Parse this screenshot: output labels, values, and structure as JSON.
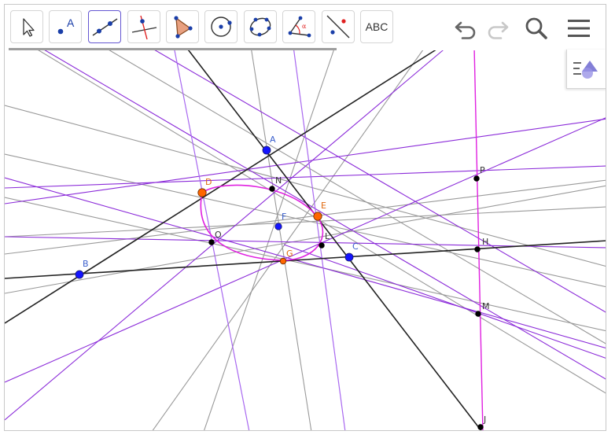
{
  "toolbar": {
    "tools": [
      {
        "name": "move-tool",
        "icon": "cursor-arrow-icon"
      },
      {
        "name": "point-tool",
        "icon": "point-icon",
        "glyph": "A"
      },
      {
        "name": "line-tool",
        "icon": "line-through-two-points-icon"
      },
      {
        "name": "perpendicular-line-tool",
        "icon": "perpendicular-line-icon"
      },
      {
        "name": "polygon-tool",
        "icon": "polygon-icon"
      },
      {
        "name": "circle-tool",
        "icon": "circle-center-point-icon"
      },
      {
        "name": "conic-tool",
        "icon": "conic-five-points-icon"
      },
      {
        "name": "angle-tool",
        "icon": "angle-icon",
        "glyph": "α"
      },
      {
        "name": "reflect-tool",
        "icon": "reflect-about-line-icon"
      },
      {
        "name": "text-tool",
        "icon": "text-icon",
        "label": "ABC"
      }
    ],
    "selected_tool": "line-tool",
    "undo_icon": "undo-icon",
    "redo_icon": "redo-icon",
    "search_icon": "search-icon",
    "menu_icon": "hamburger-menu-icon"
  },
  "style_bar": {
    "icon": "style-bar-toggle-icon"
  },
  "colors": {
    "blue_point": "#1414ff",
    "orange_point": "#ff6600",
    "black_point": "#000000",
    "purple_line": "#8b2bd9",
    "light_purple_line": "#a868f0",
    "magenta_line": "#e020e0",
    "gray_line": "#999999",
    "black_line": "#222222",
    "blue_label": "#3a5fcd",
    "orange_label": "#e06a10",
    "black_label": "#333333",
    "accent": "#6557d2"
  },
  "points": [
    {
      "label": "A",
      "kind": "blue"
    },
    {
      "label": "B",
      "kind": "blue"
    },
    {
      "label": "C",
      "kind": "blue"
    },
    {
      "label": "D",
      "kind": "orange"
    },
    {
      "label": "E",
      "kind": "orange"
    },
    {
      "label": "F",
      "kind": "blue"
    },
    {
      "label": "G",
      "kind": "orange"
    },
    {
      "label": "N",
      "kind": "black"
    },
    {
      "label": "O",
      "kind": "black"
    },
    {
      "label": "L",
      "kind": "black"
    },
    {
      "label": "P",
      "kind": "black"
    },
    {
      "label": "H",
      "kind": "black"
    },
    {
      "label": "M",
      "kind": "black"
    },
    {
      "label": "J",
      "kind": "black"
    }
  ]
}
